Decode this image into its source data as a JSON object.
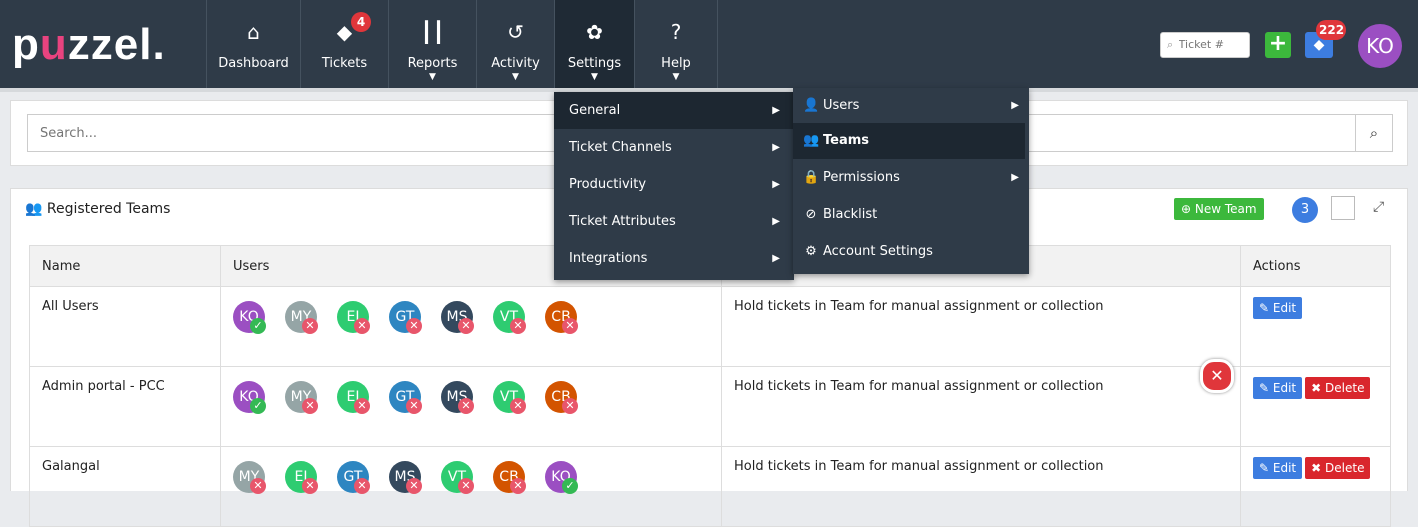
{
  "brand": {
    "logo_left": "p",
    "logo_dot": "u",
    "logo_right": "zzel."
  },
  "nav": [
    {
      "label": "Dashboard",
      "icon": "home-icon",
      "glyph": "⌂"
    },
    {
      "label": "Tickets",
      "icon": "tickets-icon",
      "glyph": "◆",
      "badge": "4"
    },
    {
      "label": "Reports",
      "icon": "bar-chart-icon",
      "glyph": "┃┃"
    },
    {
      "label": "Activity",
      "icon": "history-icon",
      "glyph": "↺"
    },
    {
      "label": "Settings",
      "icon": "gear-icon",
      "glyph": "✿"
    },
    {
      "label": "Help",
      "icon": "help-icon",
      "glyph": "?"
    }
  ],
  "topright": {
    "ticket_placeholder": "Ticket #",
    "plus": "+",
    "tag_badge": "222",
    "user_initials": "KO"
  },
  "search": {
    "placeholder": "Search..."
  },
  "panel": {
    "title": "Registered Teams",
    "new_team": "New Team",
    "count": "3"
  },
  "table": {
    "headers": [
      "Name",
      "Users",
      "Actions"
    ],
    "rows": [
      {
        "name": "All Users",
        "description": "Hold tickets in Team for manual assignment or collection"
      },
      {
        "name": "Admin portal - PCC",
        "description": "Hold tickets in Team for manual assignment or collection"
      },
      {
        "name": "Galangal",
        "description": "Hold tickets in Team for manual assignment or collection"
      }
    ],
    "edit_label": "Edit",
    "delete_label": "Delete"
  },
  "users": {
    "row1": [
      {
        "initials": "KO",
        "color": "#9b4fc2",
        "status": "ok"
      },
      {
        "initials": "MY",
        "color": "#95a5a6",
        "status": "x"
      },
      {
        "initials": "EJ",
        "color": "#2ecc71",
        "status": "x"
      },
      {
        "initials": "GT",
        "color": "#2e86c1",
        "status": "x"
      },
      {
        "initials": "MS",
        "color": "#34495e",
        "status": "x"
      },
      {
        "initials": "VT",
        "color": "#2ecc71",
        "status": "x"
      },
      {
        "initials": "CB",
        "color": "#d35400",
        "status": "x"
      }
    ],
    "row3": [
      {
        "initials": "MY",
        "color": "#95a5a6",
        "status": "x"
      },
      {
        "initials": "EJ",
        "color": "#2ecc71",
        "status": "x"
      },
      {
        "initials": "GT",
        "color": "#2e86c1",
        "status": "x"
      },
      {
        "initials": "MS",
        "color": "#34495e",
        "status": "x"
      },
      {
        "initials": "VT",
        "color": "#2ecc71",
        "status": "x"
      },
      {
        "initials": "CB",
        "color": "#d35400",
        "status": "x"
      },
      {
        "initials": "KO",
        "color": "#9b4fc2",
        "status": "ok"
      }
    ]
  },
  "settings_menu": [
    "General",
    "Ticket Channels",
    "Productivity",
    "Ticket Attributes",
    "Integrations"
  ],
  "general_submenu": [
    {
      "label": "Users",
      "icon": "user-icon",
      "glyph": "👤",
      "has_sub": true
    },
    {
      "label": "Teams",
      "icon": "teams-icon",
      "glyph": "👥",
      "has_sub": false
    },
    {
      "label": "Permissions",
      "icon": "lock-icon",
      "glyph": "🔒",
      "has_sub": true
    },
    {
      "label": "Blacklist",
      "icon": "ban-icon",
      "glyph": "⊘",
      "has_sub": false
    },
    {
      "label": "Account Settings",
      "icon": "gear-icon",
      "glyph": "⚙",
      "has_sub": false
    }
  ],
  "colors": {
    "topbar": "#2f3b48",
    "accent_blue": "#3d7de0",
    "green": "#3cb83c",
    "red": "#d9262c",
    "logo_pink": "#e8437f"
  }
}
